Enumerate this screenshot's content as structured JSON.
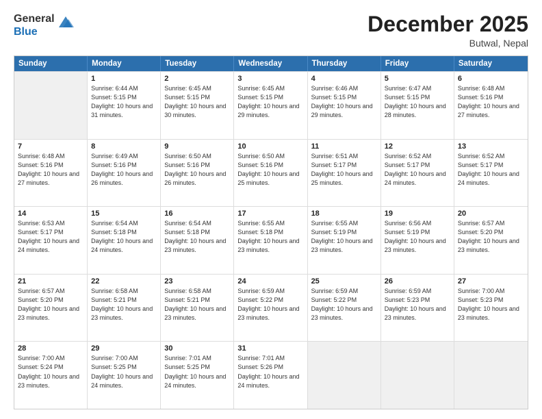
{
  "logo": {
    "general": "General",
    "blue": "Blue"
  },
  "title": "December 2025",
  "location": "Butwal, Nepal",
  "days_of_week": [
    "Sunday",
    "Monday",
    "Tuesday",
    "Wednesday",
    "Thursday",
    "Friday",
    "Saturday"
  ],
  "weeks": [
    [
      {
        "day": null,
        "shade": true
      },
      {
        "day": 1,
        "sunrise": "6:44 AM",
        "sunset": "5:15 PM",
        "daylight": "10 hours and 31 minutes."
      },
      {
        "day": 2,
        "sunrise": "6:45 AM",
        "sunset": "5:15 PM",
        "daylight": "10 hours and 30 minutes."
      },
      {
        "day": 3,
        "sunrise": "6:45 AM",
        "sunset": "5:15 PM",
        "daylight": "10 hours and 29 minutes."
      },
      {
        "day": 4,
        "sunrise": "6:46 AM",
        "sunset": "5:15 PM",
        "daylight": "10 hours and 29 minutes."
      },
      {
        "day": 5,
        "sunrise": "6:47 AM",
        "sunset": "5:15 PM",
        "daylight": "10 hours and 28 minutes."
      },
      {
        "day": 6,
        "sunrise": "6:48 AM",
        "sunset": "5:16 PM",
        "daylight": "10 hours and 27 minutes."
      }
    ],
    [
      {
        "day": 7,
        "sunrise": "6:48 AM",
        "sunset": "5:16 PM",
        "daylight": "10 hours and 27 minutes."
      },
      {
        "day": 8,
        "sunrise": "6:49 AM",
        "sunset": "5:16 PM",
        "daylight": "10 hours and 26 minutes."
      },
      {
        "day": 9,
        "sunrise": "6:50 AM",
        "sunset": "5:16 PM",
        "daylight": "10 hours and 26 minutes."
      },
      {
        "day": 10,
        "sunrise": "6:50 AM",
        "sunset": "5:16 PM",
        "daylight": "10 hours and 25 minutes."
      },
      {
        "day": 11,
        "sunrise": "6:51 AM",
        "sunset": "5:17 PM",
        "daylight": "10 hours and 25 minutes."
      },
      {
        "day": 12,
        "sunrise": "6:52 AM",
        "sunset": "5:17 PM",
        "daylight": "10 hours and 24 minutes."
      },
      {
        "day": 13,
        "sunrise": "6:52 AM",
        "sunset": "5:17 PM",
        "daylight": "10 hours and 24 minutes."
      }
    ],
    [
      {
        "day": 14,
        "sunrise": "6:53 AM",
        "sunset": "5:17 PM",
        "daylight": "10 hours and 24 minutes."
      },
      {
        "day": 15,
        "sunrise": "6:54 AM",
        "sunset": "5:18 PM",
        "daylight": "10 hours and 24 minutes."
      },
      {
        "day": 16,
        "sunrise": "6:54 AM",
        "sunset": "5:18 PM",
        "daylight": "10 hours and 23 minutes."
      },
      {
        "day": 17,
        "sunrise": "6:55 AM",
        "sunset": "5:18 PM",
        "daylight": "10 hours and 23 minutes."
      },
      {
        "day": 18,
        "sunrise": "6:55 AM",
        "sunset": "5:19 PM",
        "daylight": "10 hours and 23 minutes."
      },
      {
        "day": 19,
        "sunrise": "6:56 AM",
        "sunset": "5:19 PM",
        "daylight": "10 hours and 23 minutes."
      },
      {
        "day": 20,
        "sunrise": "6:57 AM",
        "sunset": "5:20 PM",
        "daylight": "10 hours and 23 minutes."
      }
    ],
    [
      {
        "day": 21,
        "sunrise": "6:57 AM",
        "sunset": "5:20 PM",
        "daylight": "10 hours and 23 minutes."
      },
      {
        "day": 22,
        "sunrise": "6:58 AM",
        "sunset": "5:21 PM",
        "daylight": "10 hours and 23 minutes."
      },
      {
        "day": 23,
        "sunrise": "6:58 AM",
        "sunset": "5:21 PM",
        "daylight": "10 hours and 23 minutes."
      },
      {
        "day": 24,
        "sunrise": "6:59 AM",
        "sunset": "5:22 PM",
        "daylight": "10 hours and 23 minutes."
      },
      {
        "day": 25,
        "sunrise": "6:59 AM",
        "sunset": "5:22 PM",
        "daylight": "10 hours and 23 minutes."
      },
      {
        "day": 26,
        "sunrise": "6:59 AM",
        "sunset": "5:23 PM",
        "daylight": "10 hours and 23 minutes."
      },
      {
        "day": 27,
        "sunrise": "7:00 AM",
        "sunset": "5:23 PM",
        "daylight": "10 hours and 23 minutes."
      }
    ],
    [
      {
        "day": 28,
        "sunrise": "7:00 AM",
        "sunset": "5:24 PM",
        "daylight": "10 hours and 23 minutes."
      },
      {
        "day": 29,
        "sunrise": "7:00 AM",
        "sunset": "5:25 PM",
        "daylight": "10 hours and 24 minutes."
      },
      {
        "day": 30,
        "sunrise": "7:01 AM",
        "sunset": "5:25 PM",
        "daylight": "10 hours and 24 minutes."
      },
      {
        "day": 31,
        "sunrise": "7:01 AM",
        "sunset": "5:26 PM",
        "daylight": "10 hours and 24 minutes."
      },
      {
        "day": null,
        "shade": true
      },
      {
        "day": null,
        "shade": true
      },
      {
        "day": null,
        "shade": true
      }
    ]
  ]
}
